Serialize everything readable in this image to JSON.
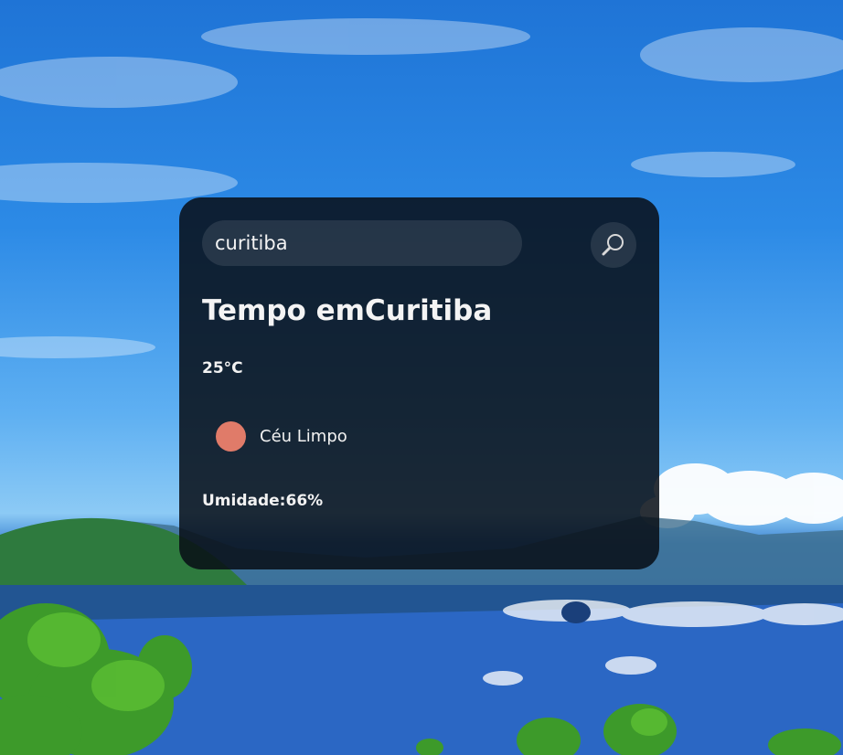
{
  "search": {
    "value": "curitiba",
    "button_icon": "search-icon"
  },
  "weather": {
    "title_prefix": "Tempo em",
    "city": "Curitiba",
    "temperature": "25°C",
    "condition_icon": "weather-condition-icon",
    "condition": "Céu Limpo",
    "humidity_label": "Umidade:",
    "humidity_value": "66%"
  },
  "colors": {
    "card_background": "#080e16",
    "condition_icon": "#e07b69",
    "text": "#f2f2f2"
  }
}
